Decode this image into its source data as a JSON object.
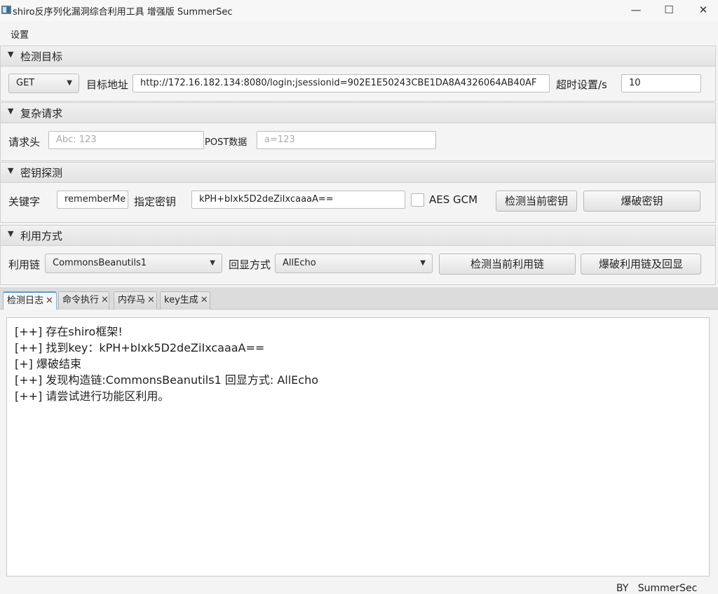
{
  "window": {
    "title": "shiro反序列化漏洞综合利用工具 增强版 SummerSec",
    "minimize": "—",
    "maximize": "☐",
    "close": "✕"
  },
  "menu": {
    "settings": "设置"
  },
  "sections": {
    "target": {
      "title": "检测目标",
      "method": "GET",
      "url_label": "目标地址",
      "url_value": "http://172.16.182.134:8080/login;jsessionid=902E1E50243CBE1DA8A4326064AB40AF",
      "timeout_label": "超时设置/s",
      "timeout_value": "10"
    },
    "complex": {
      "title": "复杂请求",
      "headers_label": "请求头",
      "headers_placeholder": "Abc: 123",
      "post_label": "POST数据",
      "post_placeholder": "a=123"
    },
    "key": {
      "title": "密钥探测",
      "keyword_label": "关键字",
      "keyword_value": "rememberMe",
      "key_label": "指定密钥",
      "key_value": "kPH+bIxk5D2deZiIxcaaaA==",
      "aes_gcm_label": "AES GCM",
      "aes_gcm_checked": false,
      "check_key_button": "检测当前密钥",
      "brute_key_button": "爆破密钥"
    },
    "exploit": {
      "title": "利用方式",
      "chain_label": "利用链",
      "chain_value": "CommonsBeanutils1",
      "echo_label": "回显方式",
      "echo_value": "AllEcho",
      "check_chain_button": "检测当前利用链",
      "brute_chain_button": "爆破利用链及回显"
    }
  },
  "tabs": [
    {
      "label": "检测日志",
      "active": true
    },
    {
      "label": "命令执行",
      "active": false
    },
    {
      "label": "内存马",
      "active": false
    },
    {
      "label": "key生成",
      "active": false
    }
  ],
  "tab_close": "✕",
  "log": [
    "[++] 存在shiro框架!",
    "[++] 找到key：kPH+bIxk5D2deZiIxcaaaA==",
    "[+] 爆破结束",
    "[++] 发现构造链:CommonsBeanutils1  回显方式: AllEcho",
    "[++] 请尝试进行功能区利用。"
  ],
  "footer": "BY   SummerSec",
  "icons": {
    "collapse": "triangle-down-icon",
    "combo": "caret-down-icon"
  }
}
